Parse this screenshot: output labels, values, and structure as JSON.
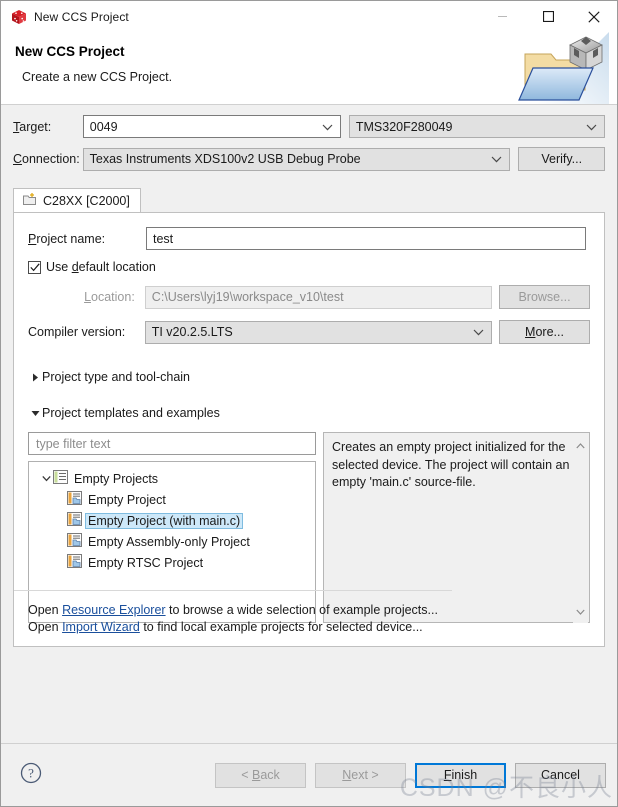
{
  "window": {
    "title": "New CCS Project",
    "icon": "ccs-cube-icon",
    "controls": {
      "minimize": "minimize-icon",
      "maximize": "maximize-icon",
      "close": "close-icon"
    }
  },
  "header": {
    "title": "New CCS Project",
    "subtitle": "Create a new CCS Project.",
    "graphic": "project-folder-cube-icon"
  },
  "target": {
    "label": "Target:",
    "label_mnemonic": "T",
    "filter_value": "0049",
    "device_value": "TMS320F280049"
  },
  "connection": {
    "label": "Connection:",
    "label_mnemonic": "C",
    "value": "Texas Instruments XDS100v2 USB Debug Probe",
    "verify_label": "Verify..."
  },
  "tab": {
    "label": "C28XX [C2000]",
    "icon": "chip-tab-icon"
  },
  "project": {
    "name_label": "Project name:",
    "name_mnemonic": "P",
    "name_value": "test",
    "use_default_label": "Use default location",
    "use_default_mnemonic": "d",
    "use_default_checked": true,
    "location_label": "Location:",
    "location_mnemonic": "L",
    "location_value": "C:\\Users\\lyj19\\workspace_v10\\test",
    "browse_label": "Browse...",
    "compiler_label": "Compiler version:",
    "compiler_value": "TI v20.2.5.LTS",
    "more_label": "More..."
  },
  "sections": {
    "project_type": {
      "label": "Project type and tool-chain",
      "expanded": false,
      "arrow": "chevron-right-icon"
    },
    "templates": {
      "label": "Project templates and examples",
      "expanded": true,
      "arrow": "chevron-down-icon"
    }
  },
  "templates": {
    "filter_placeholder": "type filter text",
    "filter_value": "",
    "tree": [
      {
        "label": "Empty Projects",
        "level": 0,
        "expanded": true,
        "selected": false,
        "icon": "folder-list-icon"
      },
      {
        "label": "Empty Project",
        "level": 1,
        "expanded": false,
        "selected": false,
        "icon": "project-file-icon"
      },
      {
        "label": "Empty Project (with main.c)",
        "level": 1,
        "expanded": false,
        "selected": true,
        "icon": "project-file-icon"
      },
      {
        "label": "Empty Assembly-only Project",
        "level": 1,
        "expanded": false,
        "selected": false,
        "icon": "project-file-icon"
      },
      {
        "label": "Empty RTSC Project",
        "level": 1,
        "expanded": false,
        "selected": false,
        "icon": "project-file-icon"
      }
    ],
    "description": "Creates an empty project initialized for the selected device. The project will contain an empty 'main.c' source-file."
  },
  "links": {
    "line1_pre": "Open ",
    "line1_link": "Resource Explorer",
    "line1_post": " to browse a wide selection of example projects...",
    "line2_pre": "Open ",
    "line2_link": "Import Wizard",
    "line2_post": " to find local example projects for selected device..."
  },
  "footer": {
    "help": "help-icon",
    "back_label": "< Back",
    "back_mnemonic": "B",
    "back_enabled": false,
    "next_label": "Next >",
    "next_mnemonic": "N",
    "next_enabled": false,
    "finish_label": "Finish",
    "finish_mnemonic": "F",
    "finish_default": true,
    "cancel_label": "Cancel"
  },
  "watermark": "CSDN @不良小人",
  "colors": {
    "accent": "#0078d7",
    "link": "#1a4f9c",
    "selection": "#cde8f9",
    "selection_border": "#7fbce0",
    "dialog_bg": "#f0f0f0",
    "field_bg": "#ffffff",
    "disabled_text": "#9a9a9a",
    "title_icon_red": "#cc0000"
  }
}
